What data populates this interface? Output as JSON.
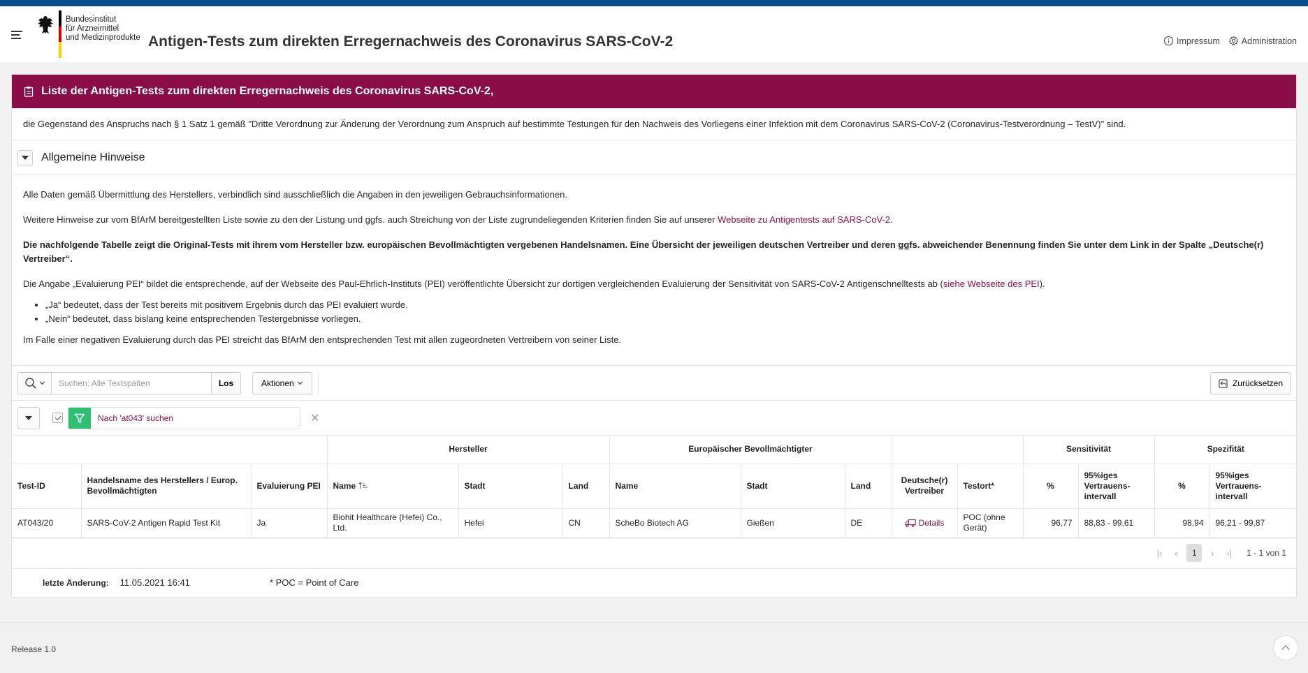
{
  "header": {
    "logo_lines": [
      "Bundesinstitut",
      "für Arzneimittel",
      "und Medizinprodukte"
    ],
    "title": "Antigen-Tests zum direkten Erregernachweis des Coronavirus SARS-CoV-2",
    "nav": {
      "impressum": "Impressum",
      "administration": "Administration"
    }
  },
  "banner": {
    "title": "Liste der Antigen-Tests zum direkten Erregernachweis des Coronavirus SARS-CoV-2,"
  },
  "intro": "die Gegenstand des Anspruchs nach § 1 Satz 1 gemäß \"Dritte Verordnung zur Änderung der Verordnung zum Anspruch auf bestimmte Testungen für den Nachweis des Vorliegens einer Infektion mit dem Coronavirus SARS-CoV-2 (Coronavirus-Testverordnung – TestV)\" sind.",
  "hints": {
    "title": "Allgemeine Hinweise",
    "p1": "Alle Daten gemäß Übermittlung des Herstellers, verbindlich sind ausschließlich die Angaben in den jeweiligen Gebrauchsinformationen.",
    "p2_before": "Weitere Hinweise zur vom BfArM bereitgestellten Liste sowie zu den der Listung und ggfs. auch Streichung von der Liste zugrundeliegenden Kriterien finden Sie auf unserer ",
    "p2_link": "Webseite zu Antigentests auf SARS-CoV-2",
    "p2_after": ".",
    "p3": "Die nachfolgende Tabelle zeigt die Original-Tests mit ihrem vom Hersteller bzw. europäischen Bevollmächtigten vergebenen Handelsnamen. Eine Übersicht der jeweiligen deutschen Vertreiber und deren ggfs. abweichender Benennung finden Sie unter dem Link in der Spalte „Deutsche(r) Vertreiber“.",
    "p4_before": "Die Angabe „Evaluierung PEI“ bildet die entsprechende, auf der Webseite des Paul-Ehrlich-Instituts (PEI) veröffentlichte Übersicht zur dortigen vergleichenden Evaluierung der Sensitivität von SARS-CoV-2 Antigenschnelltests ab (",
    "p4_link": "siehe Webseite des PEI",
    "p4_after": ").",
    "li1": "„Ja“ bedeutet, dass der Test bereits mit positivem Ergebnis durch das PEI evaluiert wurde.",
    "li2": "„Nein“ bedeutet, dass bislang keine entsprechenden Testergebnisse vorliegen.",
    "p5": "Im Falle einer negativen Evaluierung durch das PEI streicht das BfArM den entsprechenden Test mit allen zugeordneten Vertreibern von seiner Liste."
  },
  "toolbar": {
    "search_placeholder": "Suchen: Alle Textspalten",
    "go_label": "Los",
    "actions_label": "Aktionen",
    "reset_label": "Zurücksetzen"
  },
  "filter": {
    "text": "Nach 'at043' suchen"
  },
  "table": {
    "groups": {
      "hersteller": "Hersteller",
      "bevollmaechtigter": "Europäischer Bevollmächtigter",
      "sensitivitaet": "Sensitivität",
      "spezifitaet": "Spezifität"
    },
    "columns": [
      "Test-ID",
      "Handelsname des Herstellers / Europ. Bevollmächtigten",
      "Evaluierung PEI",
      "Name",
      "Stadt",
      "Land",
      "Name",
      "Stadt",
      "Land",
      "Deutsche(r) Vertreiber",
      "Testort*",
      "%",
      "95%iges Vertrauens-intervall",
      "%",
      "95%iges Vertrauens-intervall"
    ],
    "rows": [
      {
        "test_id": "AT043/20",
        "handelsname": "SARS-CoV-2 Antigen Rapid Test Kit",
        "evaluierung": "Ja",
        "h_name": "Biohit Healthcare (Hefei) Co., Ltd.",
        "h_stadt": "Hefei",
        "h_land": "CN",
        "b_name": "ScheBo Biotech AG",
        "b_stadt": "Gießen",
        "b_land": "DE",
        "vertreiber": "Details",
        "testort": "POC (ohne Gerät)",
        "sens_pct": "96,77",
        "sens_ci": "88,83 - 99,61",
        "spez_pct": "98,94",
        "spez_ci": "96,21 - 99,87"
      }
    ]
  },
  "pagination": {
    "current": "1",
    "info": "1 - 1 von 1"
  },
  "footer_info": {
    "label": "letzte Änderung:",
    "value": "11.05.2021 16:41",
    "note": "* POC = Point of Care"
  },
  "release": "Release 1.0",
  "colors": {
    "brand": "#8b0d48",
    "topbar": "#0a4d8c",
    "filter": "#2ebf73"
  }
}
